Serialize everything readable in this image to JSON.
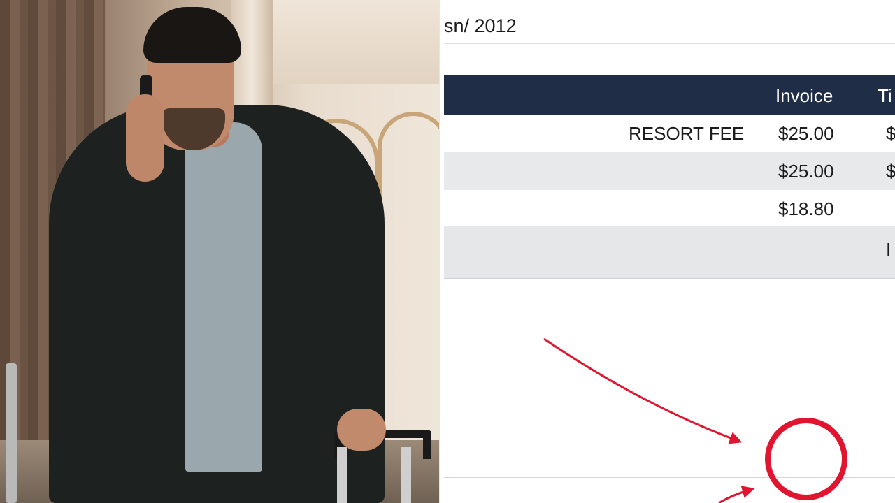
{
  "photo": {
    "alt": "man on phone with suitcase in hotel lobby"
  },
  "document": {
    "top_fragment": "",
    "date_text": "sn/ 2012",
    "header": {
      "invoice_label": "Invoice",
      "tail_label": "Ti"
    },
    "rows": [
      {
        "description": "RESORT FEE",
        "amount": "$25.00",
        "tail": "$"
      },
      {
        "description": "",
        "amount": "$25.00",
        "tail": "$"
      },
      {
        "description": "",
        "amount": "$18.80",
        "tail": ""
      },
      {
        "description": "",
        "amount": "",
        "tail": "I"
      }
    ]
  },
  "annotation": {
    "color": "#e01530",
    "shape": "circle-with-arrows"
  },
  "colors": {
    "header_bg": "#1f2d47",
    "row_alt_bg": "#e8e9eb",
    "accent": "#e01530"
  }
}
